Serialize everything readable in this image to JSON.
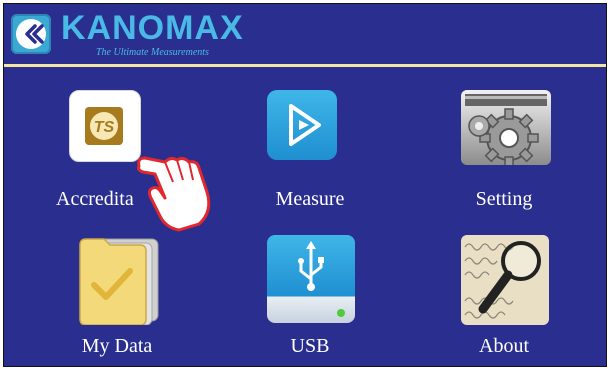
{
  "header": {
    "brand": "KANOMAX",
    "tagline": "The Ultimate Measurements"
  },
  "menu": {
    "items": [
      {
        "label": "Accreditation",
        "visible_label": "Accredita",
        "icon": "accreditation-ts-icon"
      },
      {
        "label": "Measure",
        "icon": "play-triangle-icon"
      },
      {
        "label": "Setting",
        "icon": "gear-icon"
      },
      {
        "label": "My Data",
        "icon": "folder-check-icon"
      },
      {
        "label": "USB",
        "icon": "usb-drive-icon"
      },
      {
        "label": "About",
        "icon": "magnifier-icon"
      }
    ]
  },
  "colors": {
    "background": "#2a2f8f",
    "accent": "#49b9e6",
    "header_line": "#f2e6a6"
  }
}
